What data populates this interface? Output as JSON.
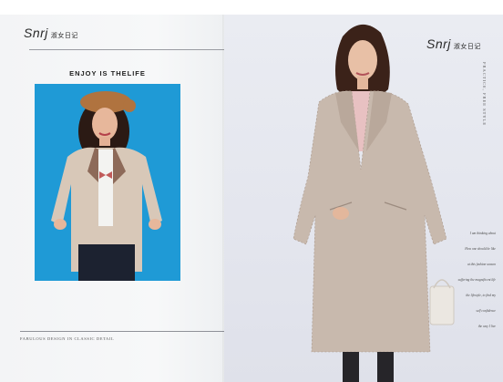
{
  "left_page": {
    "logo_mark": "Snrj",
    "logo_cn": "淑女日记",
    "headline": "ENJOY IS THELIFE",
    "footer_caption": "FABULOUS DESIGN IN CLASSIC DETAIL"
  },
  "right_page": {
    "logo_mark": "Snrj",
    "logo_cn": "淑女日记",
    "vertical_text": "PRACTICE, FREE STYLE",
    "blurb_lines": [
      "I am thinking about",
      "How one should be like",
      "at this fashion season",
      "suffering the magnificent life",
      "the lifestyle, to find my",
      "self confidence",
      "the way I live"
    ]
  },
  "colors": {
    "left_background": "#f5f6f7",
    "right_background": "#e4e6ee",
    "photo_backdrop": "#1f9ad6",
    "coat": "#c9b9ab",
    "text_dark": "#222222"
  }
}
